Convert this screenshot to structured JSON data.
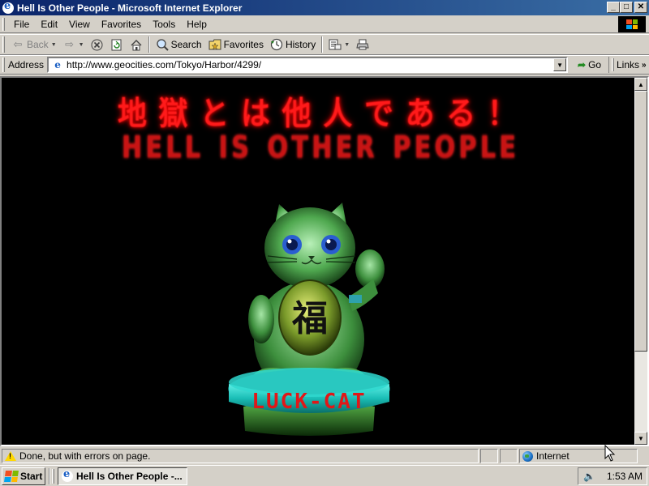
{
  "window": {
    "title": "Hell Is Other People - Microsoft Internet Explorer",
    "btn_min": "_",
    "btn_max": "□",
    "btn_close": "✕"
  },
  "menu": {
    "items": [
      {
        "label": "File"
      },
      {
        "label": "Edit"
      },
      {
        "label": "View"
      },
      {
        "label": "Favorites"
      },
      {
        "label": "Tools"
      },
      {
        "label": "Help"
      }
    ]
  },
  "toolbar": {
    "back": "Back",
    "search": "Search",
    "favorites": "Favorites",
    "history": "History"
  },
  "address": {
    "label": "Address",
    "url": "http://www.geocities.com/Tokyo/Harbor/4299/",
    "go": "Go",
    "links": "Links"
  },
  "page": {
    "banner_jp": [
      "地",
      "獄",
      "と",
      "は",
      "他",
      "人",
      "で",
      "あ",
      "る",
      "！"
    ],
    "banner_en": [
      "H",
      "E",
      "L",
      "L",
      "I",
      "S",
      "O",
      "T",
      "H",
      "E",
      "R",
      "P",
      "E",
      "O",
      "P",
      "L",
      "E"
    ],
    "coin_kanji": "福",
    "base_text": "LUCK-CAT"
  },
  "status": {
    "text": "Done, but with errors on page.",
    "zone": "Internet"
  },
  "taskbar": {
    "start": "Start",
    "task": "Hell Is Other People -...",
    "time": "1:53 AM"
  },
  "colors": {
    "title_bar": "#0a246a",
    "chrome": "#d4d0c8",
    "page_bg": "#000000",
    "banner_red": "#ff1a1a",
    "cat_green": "#5fbf5f",
    "base_cyan": "#1ec8c8"
  }
}
